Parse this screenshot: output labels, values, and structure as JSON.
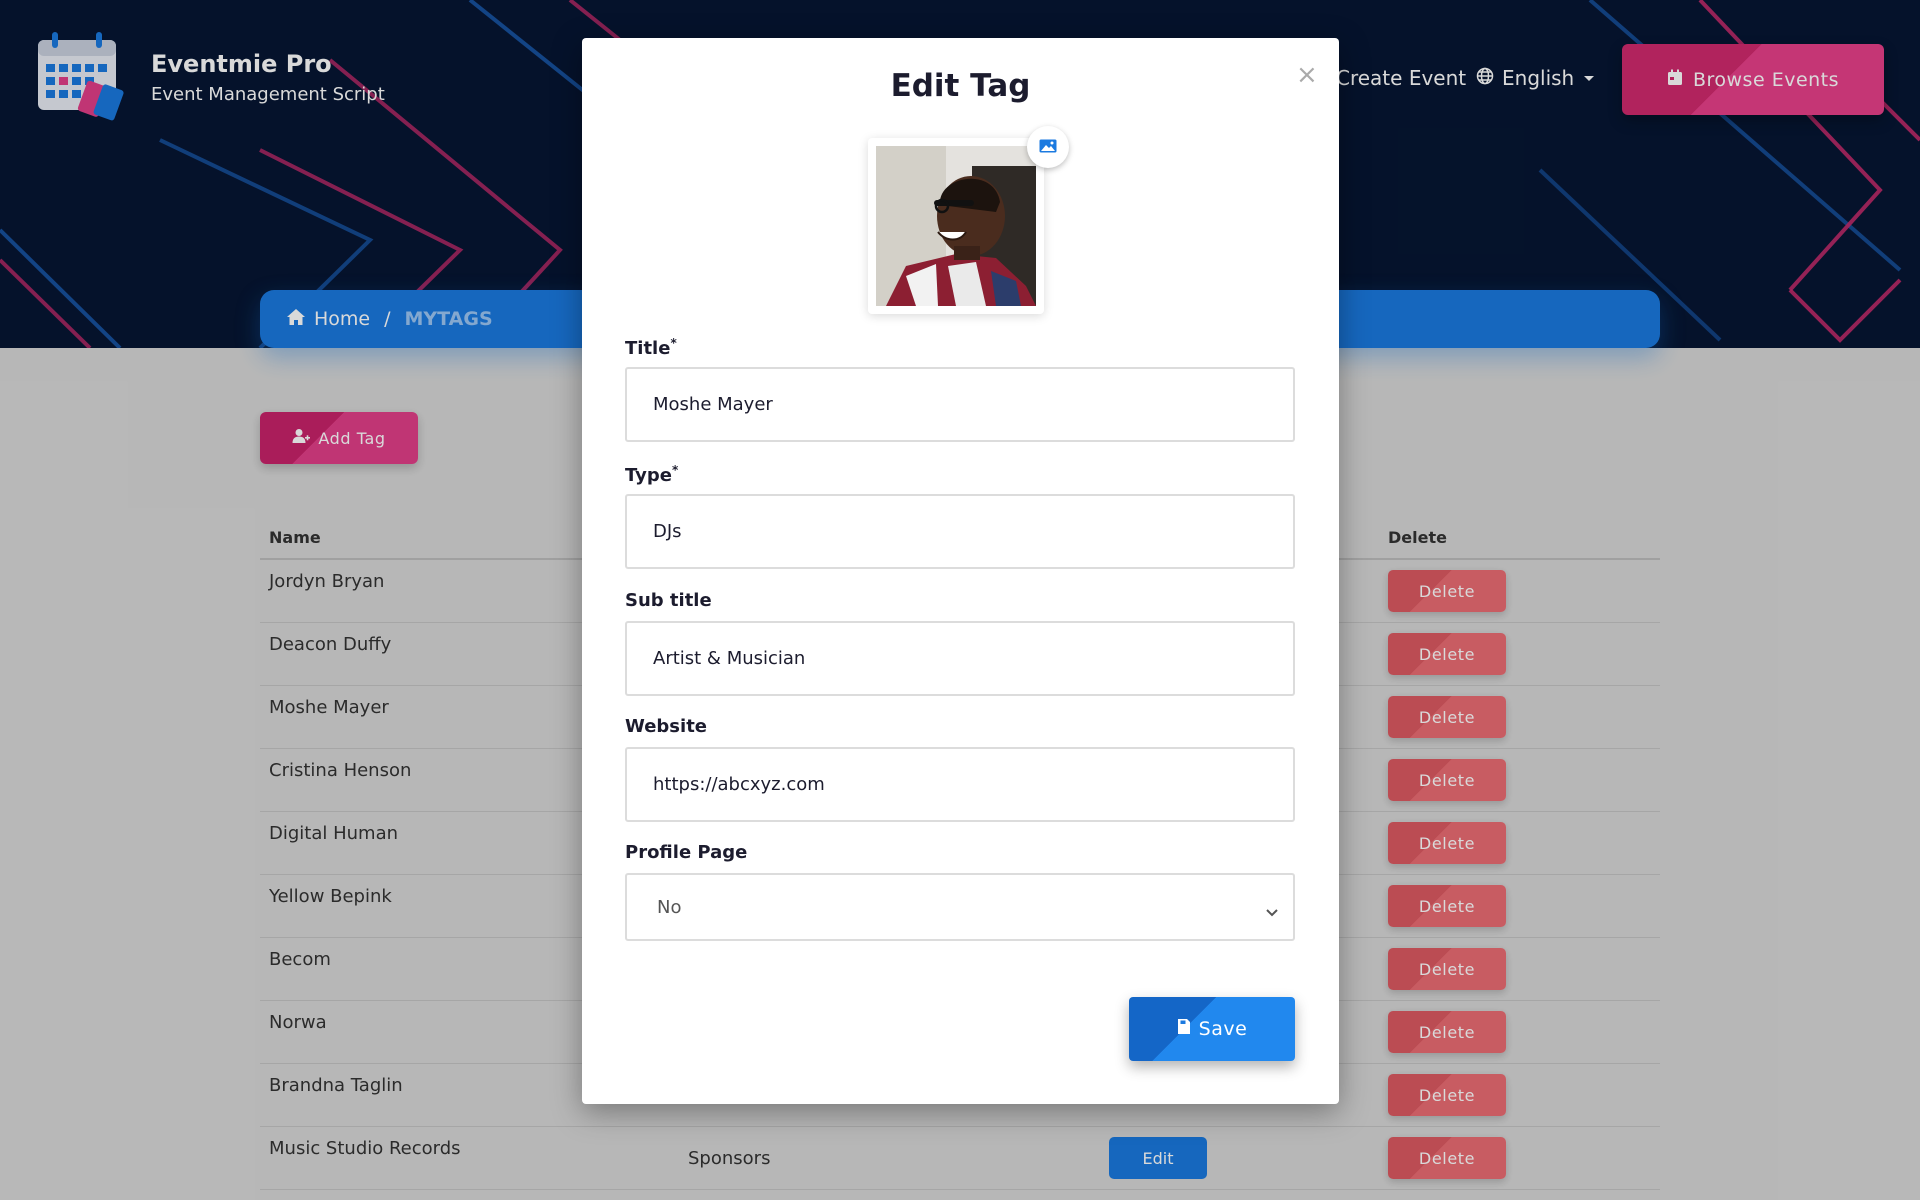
{
  "header": {
    "brand_name": "Eventmie Pro",
    "brand_sub": "Event Management Script",
    "nav_create": "Create Event",
    "nav_language": "English",
    "browse_button": "Browse Events"
  },
  "breadcrumb": {
    "home": "Home",
    "separator": "/",
    "current": "MYTAGS"
  },
  "page": {
    "add_tag_button": "Add Tag"
  },
  "table": {
    "headers": {
      "name": "Name",
      "delete": "Delete"
    },
    "rows": [
      {
        "name": "Jordyn Bryan",
        "delete": "Delete"
      },
      {
        "name": "Deacon Duffy",
        "delete": "Delete"
      },
      {
        "name": "Moshe Mayer",
        "delete": "Delete"
      },
      {
        "name": "Cristina Henson",
        "delete": "Delete"
      },
      {
        "name": "Digital Human",
        "delete": "Delete"
      },
      {
        "name": "Yellow Bepink",
        "delete": "Delete"
      },
      {
        "name": "Becom",
        "delete": "Delete"
      },
      {
        "name": "Norwa",
        "delete": "Delete"
      },
      {
        "name": "Brandna Taglin",
        "delete": "Delete"
      },
      {
        "name": "Music Studio Records",
        "type": "Sponsors",
        "edit": "Edit",
        "delete": "Delete"
      }
    ]
  },
  "modal": {
    "title": "Edit Tag",
    "close": "×",
    "fields": {
      "title_label": "Title",
      "title_required": "*",
      "title_value": "Moshe Mayer",
      "type_label": "Type",
      "type_required": "*",
      "type_value": "DJs",
      "subtitle_label": "Sub title",
      "subtitle_value": "Artist & Musician",
      "website_label": "Website",
      "website_value": "https://abcxyz.com",
      "profile_label": "Profile Page",
      "profile_value": "No"
    },
    "save_button": "Save"
  },
  "colors": {
    "hero_bg": "#061633",
    "accent_pink": "#e23f89",
    "accent_blue": "#1b7ae0",
    "delete_red": "#ec6d74"
  },
  "icons": [
    "calendar-logo-icon",
    "globe-icon",
    "calendar-icon",
    "home-icon",
    "user-add-icon",
    "image-icon",
    "save-icon",
    "chevron-down-icon"
  ]
}
